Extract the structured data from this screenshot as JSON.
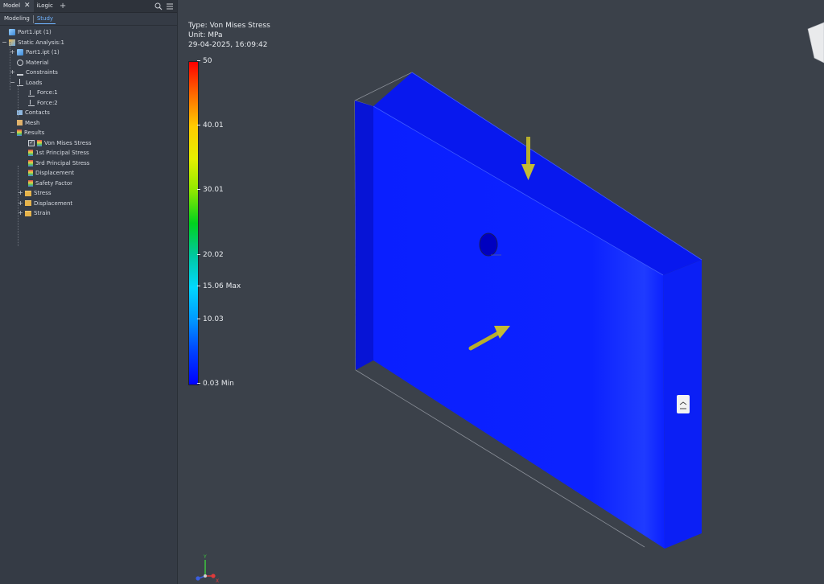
{
  "tabs": [
    {
      "label": "Model",
      "close": "✕"
    },
    {
      "label": "iLogic"
    }
  ],
  "modes": [
    "Modeling",
    "Study"
  ],
  "tree": [
    {
      "label": "Part1.ipt (1)",
      "icon": "part-icon",
      "depth": 0,
      "expander": ""
    },
    {
      "label": "Static Analysis:1",
      "icon": "study-icon",
      "depth": 0,
      "expander": "−"
    },
    {
      "label": "Part1.ipt (1)",
      "icon": "part-icon",
      "depth": 1,
      "expander": "+"
    },
    {
      "label": "Material",
      "icon": "material-icon",
      "depth": 1,
      "expander": ""
    },
    {
      "label": "Constraints",
      "icon": "constraint-icon",
      "depth": 1,
      "expander": "+"
    },
    {
      "label": "Loads",
      "icon": "load-icon",
      "depth": 1,
      "expander": "−"
    },
    {
      "label": "Force:1",
      "icon": "force-icon",
      "depth": 2,
      "expander": ""
    },
    {
      "label": "Force:2",
      "icon": "force-icon",
      "depth": 2,
      "expander": ""
    },
    {
      "label": "Contacts",
      "icon": "contact-icon",
      "depth": 1,
      "expander": ""
    },
    {
      "label": "Mesh",
      "icon": "mesh-icon",
      "depth": 1,
      "expander": ""
    },
    {
      "label": "Results",
      "icon": "results-icon",
      "depth": 1,
      "expander": "−"
    },
    {
      "label": "Von Mises Stress",
      "icon": "result-plot-icon",
      "depth": 2,
      "expander": "",
      "checked": true
    },
    {
      "label": "1st Principal Stress",
      "icon": "result-plot-icon",
      "depth": 2,
      "expander": ""
    },
    {
      "label": "3rd Principal Stress",
      "icon": "result-plot-icon",
      "depth": 2,
      "expander": ""
    },
    {
      "label": "Displacement",
      "icon": "result-plot-icon",
      "depth": 2,
      "expander": ""
    },
    {
      "label": "Safety Factor",
      "icon": "result-plot-icon",
      "depth": 2,
      "expander": ""
    },
    {
      "label": "Stress",
      "icon": "folder-icon",
      "depth": 2,
      "expander": "+"
    },
    {
      "label": "Displacement",
      "icon": "folder-icon",
      "depth": 2,
      "expander": "+"
    },
    {
      "label": "Strain",
      "icon": "folder-icon",
      "depth": 2,
      "expander": "+"
    }
  ],
  "legend": {
    "type_line": "Type: Von Mises Stress",
    "unit_line": "Unit: MPa",
    "timestamp": "29-04-2025, 16:09:42",
    "ticks": [
      "50",
      "40.01",
      "30.01",
      "20.02",
      "15.06 Max",
      "10.03",
      "0.03 Min"
    ],
    "tick_values": [
      50,
      40.01,
      30.01,
      20.02,
      15.06,
      10.03,
      0.03
    ],
    "range": [
      0.03,
      50
    ]
  },
  "axes": {
    "x": "X",
    "y": "Y",
    "z": "Z"
  },
  "colors": {
    "panel_bg": "#353b45",
    "viewport_bg": "#3b414a",
    "accent": "#6fb3ff",
    "part_face": "#0a1fff",
    "load_arrow": "#b7ae2c"
  }
}
